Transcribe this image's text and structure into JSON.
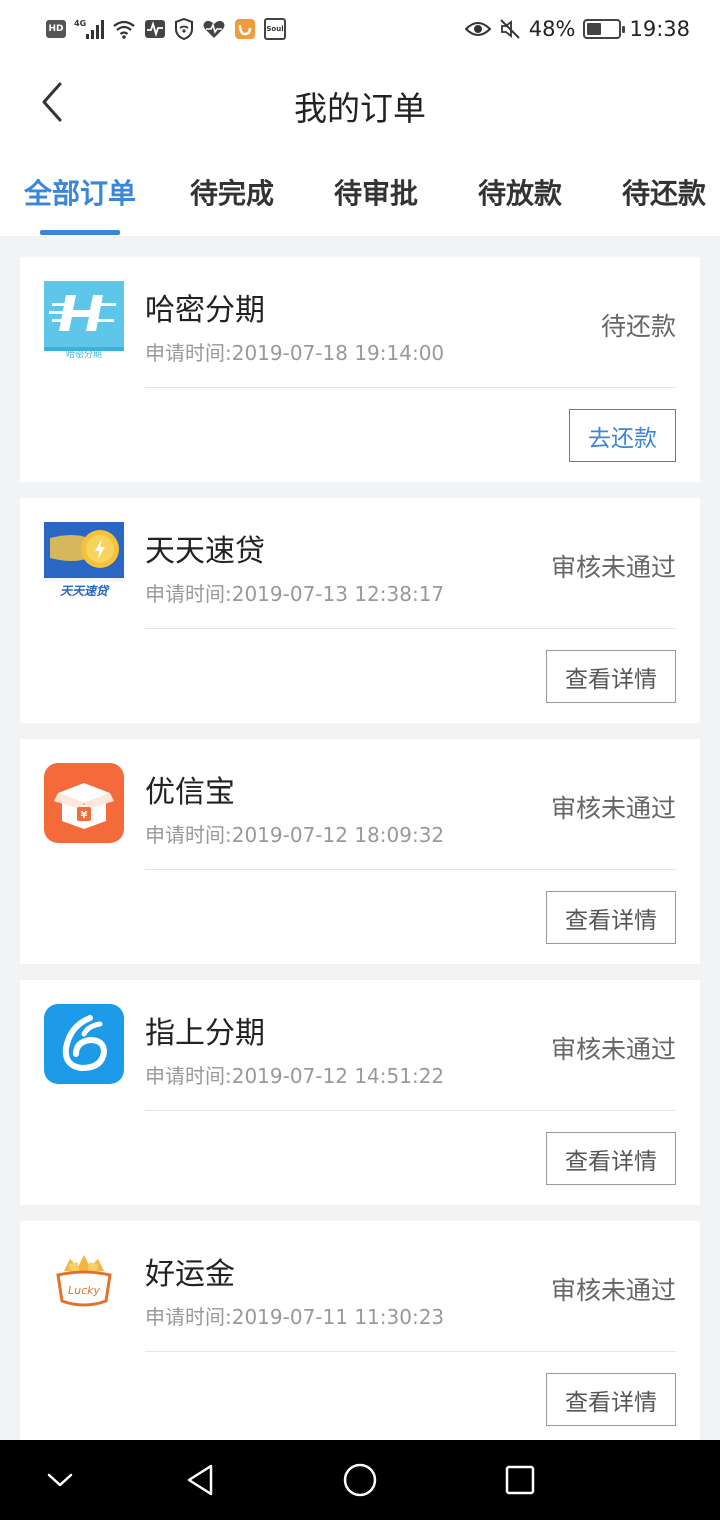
{
  "status_bar": {
    "battery": "48%",
    "time": "19:38",
    "net_label": "4G",
    "hd_label": "HD",
    "soul_label": "Soul"
  },
  "header": {
    "title": "我的订单"
  },
  "tabs": [
    {
      "label": "全部订单",
      "active": true
    },
    {
      "label": "待完成",
      "active": false
    },
    {
      "label": "待审批",
      "active": false
    },
    {
      "label": "待放款",
      "active": false
    },
    {
      "label": "待还款",
      "active": false
    }
  ],
  "orders": [
    {
      "name": "哈密分期",
      "logo_caption": "哈密分期",
      "time": "申请时间:2019-07-18 19:14:00",
      "status": "待还款",
      "action": "去还款"
    },
    {
      "name": "天天速贷",
      "logo_caption": "天天速贷",
      "time": "申请时间:2019-07-13 12:38:17",
      "status": "审核未通过",
      "action": "查看详情"
    },
    {
      "name": "优信宝",
      "logo_caption": "¥",
      "time": "申请时间:2019-07-12 18:09:32",
      "status": "审核未通过",
      "action": "查看详情"
    },
    {
      "name": "指上分期",
      "time": "申请时间:2019-07-12 14:51:22",
      "status": "审核未通过",
      "action": "查看详情"
    },
    {
      "name": "好运金",
      "logo_caption": "Lucky",
      "time": "申请时间:2019-07-11 11:30:23",
      "status": "审核未通过",
      "action": "查看详情"
    }
  ],
  "colors": {
    "accent": "#3a86d9",
    "background": "#f2f3f5",
    "nav_bar": "#000000"
  },
  "icons": {
    "back": "chevron-left-icon",
    "nav": [
      "chevron-down-icon",
      "back-triangle-icon",
      "home-circle-icon",
      "recents-square-icon"
    ]
  }
}
